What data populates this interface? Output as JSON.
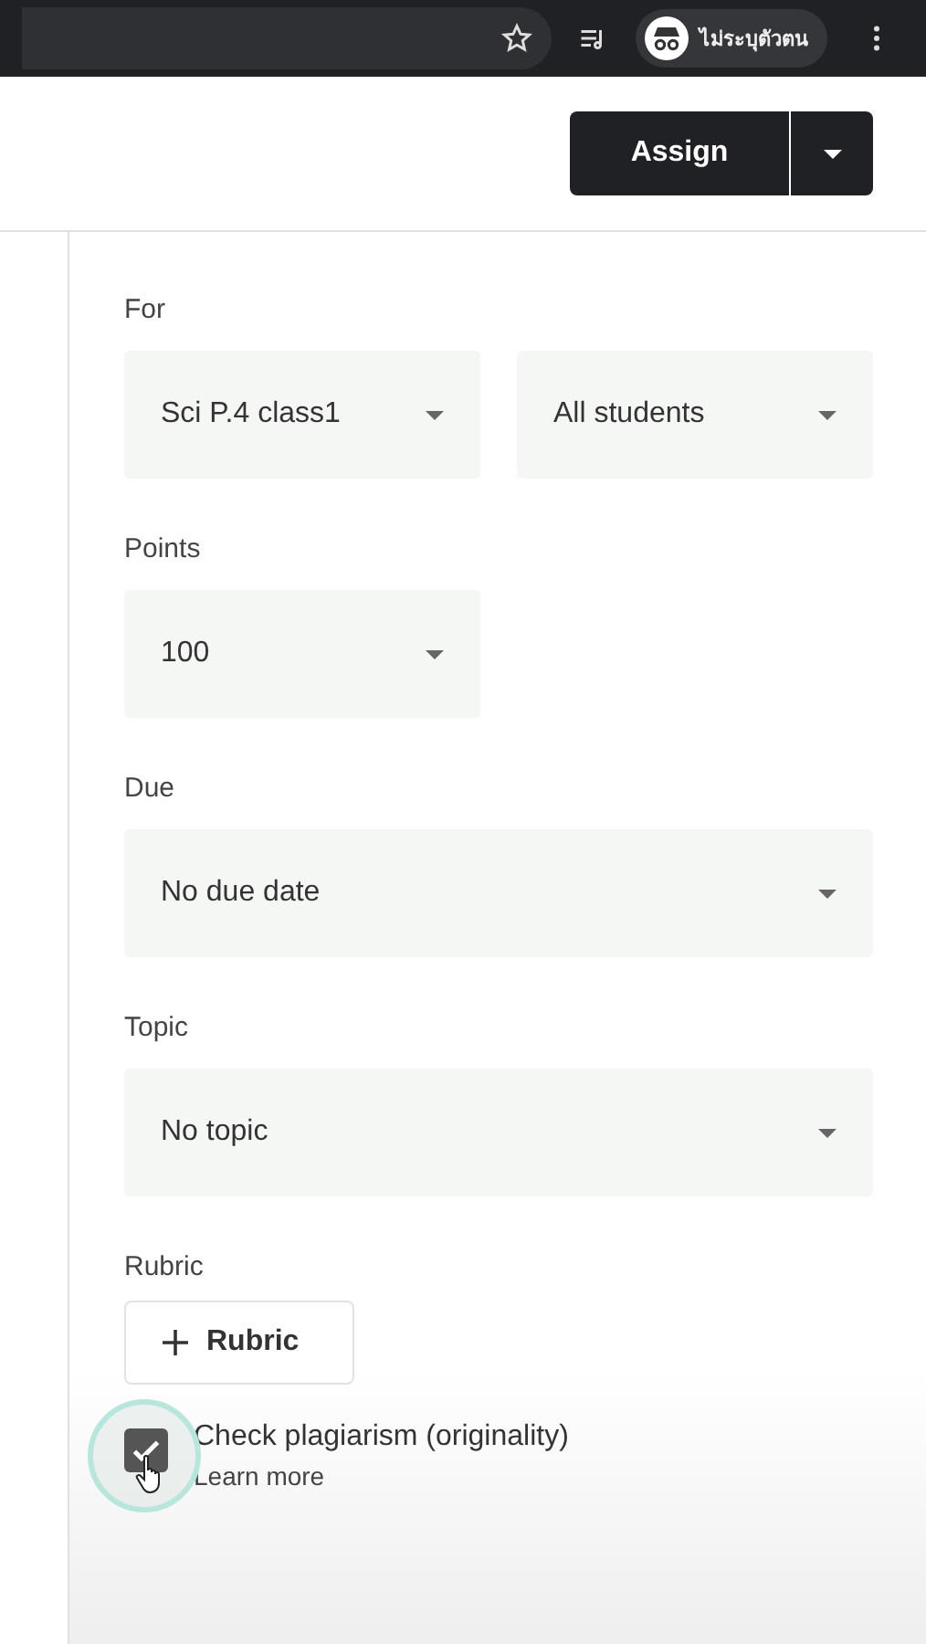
{
  "browser_bar": {
    "profile_label": "ไม่ระบุตัวตน"
  },
  "header": {
    "assign_button": "Assign"
  },
  "fields": [
    {
      "label": "For",
      "selects": [
        {
          "value": "Sci P.4 class1",
          "kind": "short"
        },
        {
          "value": "All students",
          "kind": "short"
        }
      ]
    },
    {
      "label": "Points",
      "selects": [
        {
          "value": "100",
          "kind": "short"
        }
      ]
    },
    {
      "label": "Due",
      "selects": [
        {
          "value": "No due date",
          "kind": "long"
        }
      ]
    },
    {
      "label": "Topic",
      "selects": [
        {
          "value": "No topic",
          "kind": "long"
        }
      ]
    }
  ],
  "rubric": {
    "label": "Rubric",
    "button": "Rubric"
  },
  "plagiarism": {
    "label": "Check plagiarism (originality)",
    "link": "Learn more",
    "checked": true
  }
}
